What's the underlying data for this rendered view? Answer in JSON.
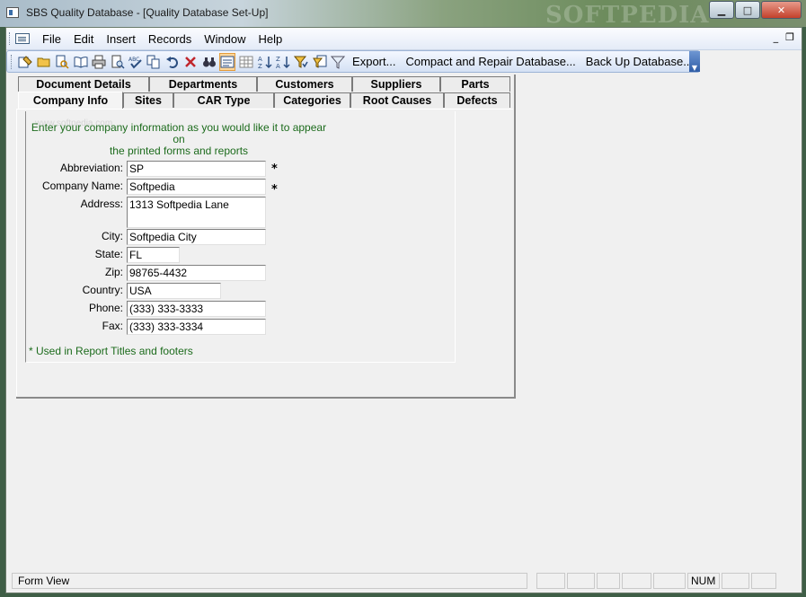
{
  "window": {
    "title": "SBS Quality Database - [Quality Database Set-Up]",
    "watermark": "SOFTPEDIA",
    "minimize": "▁",
    "maximize": "□",
    "close": "✕"
  },
  "menubar": {
    "items": [
      "File",
      "Edit",
      "Insert",
      "Records",
      "Window",
      "Help"
    ],
    "mdi_minimize": "_",
    "mdi_restore": "❐"
  },
  "toolbar": {
    "export_label": "Export...",
    "compact_label": "Compact and Repair Database...",
    "backup_label": "Back Up Database...",
    "overflow": "▼"
  },
  "tabs": {
    "row1": [
      "Document Details",
      "Departments",
      "Customers",
      "Suppliers",
      "Parts"
    ],
    "row2": [
      "Company Info",
      "Sites",
      "CAR Type",
      "Categories",
      "Root Causes",
      "Defects"
    ],
    "active": "Company Info"
  },
  "company_form": {
    "ghost_url": "www.softpedia.com",
    "instructions_line1": "Enter your company information as you would like it to appear on",
    "instructions_line2": "the printed forms and reports",
    "required_mark": "*",
    "footnote": "* Used in Report Titles and footers",
    "fields": {
      "abbreviation": {
        "label": "Abbreviation:",
        "value": "SP"
      },
      "company_name": {
        "label": "Company Name:",
        "value": "Softpedia"
      },
      "address": {
        "label": "Address:",
        "value": "1313 Softpedia Lane"
      },
      "city": {
        "label": "City:",
        "value": "Softpedia City"
      },
      "state": {
        "label": "State:",
        "value": "FL"
      },
      "zip": {
        "label": "Zip:",
        "value": "98765-4432"
      },
      "country": {
        "label": "Country:",
        "value": "USA"
      },
      "phone": {
        "label": "Phone:",
        "value": "(333) 333-3333"
      },
      "fax": {
        "label": "Fax:",
        "value": "(333) 333-3334"
      }
    }
  },
  "statusbar": {
    "view": "Form View",
    "num": "NUM"
  },
  "colors": {
    "hint_text": "#1c6b1c",
    "active_toolbar_button": "#ffd69a"
  }
}
